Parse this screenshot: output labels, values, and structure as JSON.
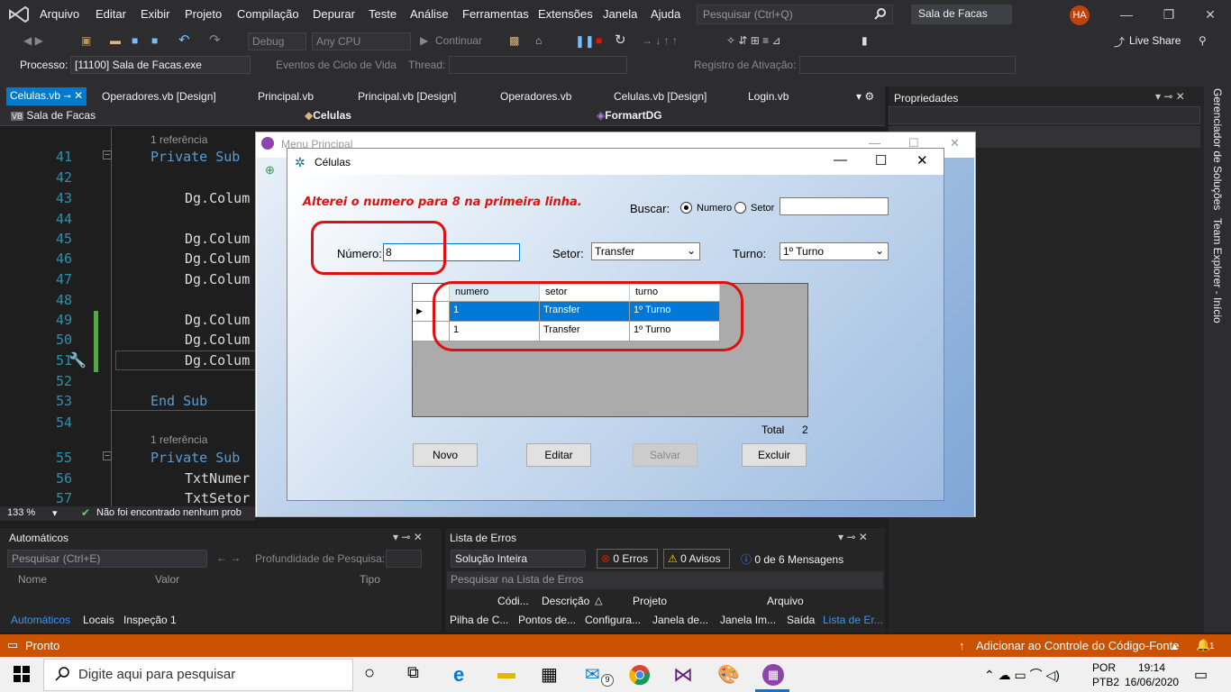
{
  "menubar": {
    "items": [
      "Arquivo",
      "Editar",
      "Exibir",
      "Projeto",
      "Compilação",
      "Depurar",
      "Teste",
      "Análise",
      "Ferramentas",
      "Extensões",
      "Janela",
      "Ajuda"
    ],
    "search_placeholder": "Pesquisar (Ctrl+Q)",
    "project": "Sala de Facas",
    "avatar": "HA"
  },
  "toolbar": {
    "config": "Debug",
    "platform": "Any CPU",
    "continue": "Continuar",
    "liveshare": "Live Share"
  },
  "procbar": {
    "label": "Processo:",
    "process": "[11100] Sala de Facas.exe",
    "events": "Eventos de Ciclo de Vida",
    "thread": "Thread:",
    "stack": "Registro de Ativação:"
  },
  "tabs": [
    "Celulas.vb",
    "Operadores.vb [Design]",
    "Principal.vb",
    "Principal.vb [Design]",
    "Operadores.vb",
    "Celulas.vb [Design]",
    "Login.vb"
  ],
  "nav": {
    "project": "Sala de Facas",
    "class": "Celulas",
    "method": "FormartDG"
  },
  "editor": {
    "lines": [
      {
        "n": "41",
        "ref": "1 referência",
        "text": "Private Sub",
        "kw": true
      },
      {
        "n": "42",
        "text": ""
      },
      {
        "n": "43",
        "text": "Dg.Colum"
      },
      {
        "n": "44",
        "text": ""
      },
      {
        "n": "45",
        "text": "Dg.Colum"
      },
      {
        "n": "46",
        "text": "Dg.Colum"
      },
      {
        "n": "47",
        "text": "Dg.Colum"
      },
      {
        "n": "48",
        "text": ""
      },
      {
        "n": "49",
        "text": "Dg.Colum"
      },
      {
        "n": "50",
        "text": "Dg.Colum"
      },
      {
        "n": "51",
        "text": "Dg.Colum"
      },
      {
        "n": "52",
        "text": ""
      },
      {
        "n": "53",
        "text": "End Sub",
        "kw": true
      },
      {
        "n": "54",
        "text": ""
      },
      {
        "n": "55",
        "ref": "1 referência",
        "text": "Private Sub",
        "kw": true
      },
      {
        "n": "56",
        "text": "TxtNumer"
      },
      {
        "n": "57",
        "text": "TxtSetor"
      }
    ],
    "zoom": "133 %",
    "status": "Não foi encontrado nenhum prob"
  },
  "properties": {
    "title": "Propriedades"
  },
  "sidebar": {
    "solution": "Gerenciador de Soluções",
    "team": "Team Explorer - Início"
  },
  "auto": {
    "title": "Automáticos",
    "search": "Pesquisar (Ctrl+E)",
    "depth": "Profundidade de Pesquisa:",
    "cols": [
      "Nome",
      "Valor",
      "Tipo"
    ],
    "tabs": [
      "Automáticos",
      "Locais",
      "Inspeção 1"
    ]
  },
  "errors": {
    "title": "Lista de Erros",
    "scope": "Solução Inteira",
    "errors": "0 Erros",
    "warnings": "0 Avisos",
    "messages": "0 de 6 Mensagens",
    "search": "Pesquisar na Lista de Erros",
    "cols": [
      "Códi...",
      "Descrição",
      "Projeto",
      "Arquivo"
    ],
    "tabs": [
      "Pilha de C...",
      "Pontos de...",
      "Configura...",
      "Janela de...",
      "Janela Im...",
      "Saída",
      "Lista de Er..."
    ]
  },
  "status": {
    "ready": "Pronto",
    "source": "Adicionar ao Controle do Código-Fonte",
    "notif": "1"
  },
  "taskbar": {
    "search": "Digite aqui para pesquisar",
    "mail_badge": "9",
    "lang1": "POR",
    "lang2": "PTB2",
    "time": "19:14",
    "date": "16/06/2020"
  },
  "menu_principal": {
    "title": "Menu Principal"
  },
  "dialog": {
    "title": "Células",
    "annotation": "Alterei o numero para 8 na primeira linha.",
    "buscar": "Buscar:",
    "radio_numero": "Numero",
    "radio_setor": "Setor",
    "numero_label": "Número:",
    "numero_value": "8",
    "setor_label": "Setor:",
    "setor_value": "Transfer",
    "turno_label": "Turno:",
    "turno_value": "1º Turno",
    "grid": {
      "headers": [
        "numero",
        "setor",
        "turno"
      ],
      "rows": [
        [
          "1",
          "Transfer",
          "1º Turno"
        ],
        [
          "1",
          "Transfer",
          "1º Turno"
        ]
      ]
    },
    "total_label": "Total",
    "total_value": "2",
    "buttons": [
      "Novo",
      "Editar",
      "Salvar",
      "Excluir"
    ]
  }
}
